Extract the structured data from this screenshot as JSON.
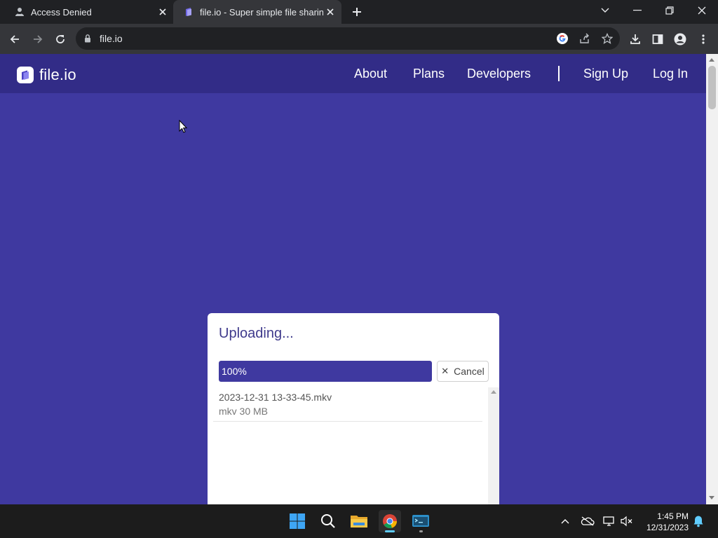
{
  "browser": {
    "tabs": [
      {
        "title": "Access Denied",
        "favicon": "access-denied-favicon-icon",
        "active": false
      },
      {
        "title": "file.io - Super simple file sharing",
        "favicon": "fileio-favicon-icon",
        "active": true
      }
    ],
    "address": "file.io"
  },
  "site": {
    "logo_text": "file.io",
    "nav": {
      "about": "About",
      "plans": "Plans",
      "developers": "Developers",
      "signup": "Sign Up",
      "login": "Log In"
    },
    "colors": {
      "background": "#3f39a0",
      "navbar": "#322c87",
      "accent": "#3f39a0"
    }
  },
  "upload": {
    "title": "Uploading...",
    "progress_label": "100%",
    "progress": 1.0,
    "cancel_label": "Cancel",
    "file": {
      "name": "2023-12-31 13-33-45.mkv",
      "meta": "mkv 30 MB"
    }
  },
  "taskbar": {
    "apps": [
      "start-icon",
      "search-icon",
      "file-explorer-icon",
      "chrome-icon",
      "terminal-icon"
    ],
    "time": "1:45 PM",
    "date": "12/31/2023"
  }
}
